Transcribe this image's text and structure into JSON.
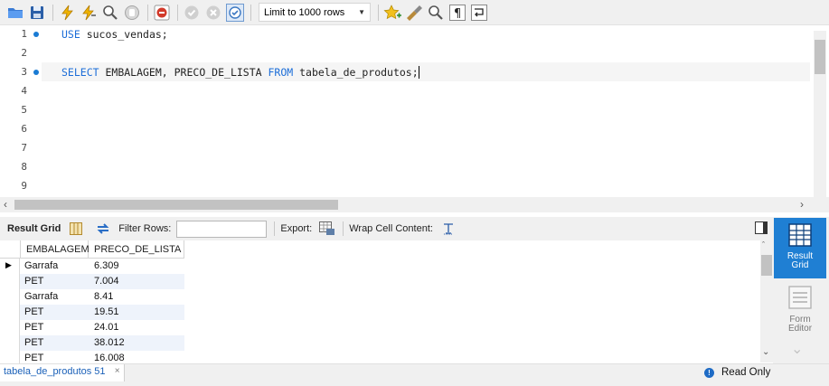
{
  "toolbar": {
    "limit_select_value": "Limit to 1000 rows",
    "icons": [
      "open-folder-icon",
      "save-icon",
      "execute-icon",
      "execute-current-icon",
      "explain-icon",
      "stop-icon",
      "toggle-error-icon",
      "commit-icon",
      "rollback-icon",
      "autocommit-icon",
      "add-snippet-icon",
      "beautify-icon",
      "find-icon",
      "invisible-chars-icon",
      "wrap-icon"
    ]
  },
  "editor": {
    "line_numbers": [
      "1",
      "2",
      "3",
      "4",
      "5",
      "6",
      "7",
      "8",
      "9"
    ],
    "lines": {
      "line1_kw": "USE",
      "line1_rest": " sucos_vendas;",
      "line3_kw1": "SELECT",
      "line3_mid": " EMBALAGEM, PRECO_DE_LISTA ",
      "line3_kw2": "FROM",
      "line3_rest": " tabela_de_produtos;"
    }
  },
  "result_toolbar": {
    "result_grid_label": "Result Grid",
    "filter_rows_label": "Filter Rows:",
    "export_label": "Export:",
    "wrap_cell_label": "Wrap Cell Content:"
  },
  "grid": {
    "columns": [
      "EMBALAGEM",
      "PRECO_DE_LISTA"
    ],
    "rows": [
      [
        "Garrafa",
        "6.309"
      ],
      [
        "PET",
        "7.004"
      ],
      [
        "Garrafa",
        "8.41"
      ],
      [
        "PET",
        "19.51"
      ],
      [
        "PET",
        "24.01"
      ],
      [
        "PET",
        "38.012"
      ],
      [
        "PET",
        "16.008"
      ]
    ]
  },
  "side_panel": {
    "result_grid_line1": "Result",
    "result_grid_line2": "Grid",
    "form_editor_line1": "Form",
    "form_editor_line2": "Editor"
  },
  "status": {
    "tab_label": "tabela_de_produtos 51",
    "read_only": "Read Only"
  },
  "colors": {
    "keyword": "#1d6ed8",
    "accent": "#1f7fd3",
    "alt_row": "#eef3fb"
  }
}
